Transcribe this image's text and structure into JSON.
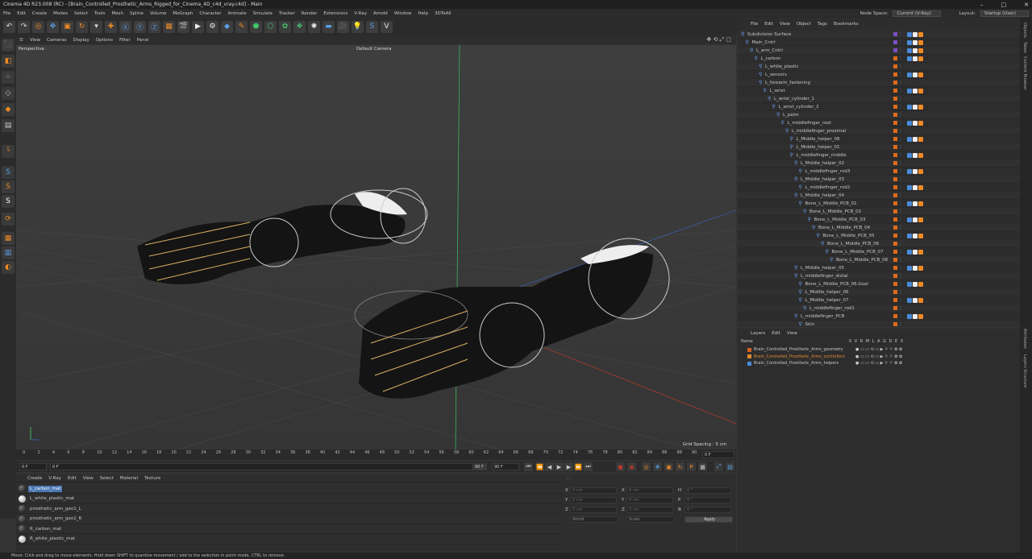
{
  "title": "Cinema 4D R23.008 (RC) - [Brain_Controlled_Prosthetic_Arms_Rigged_for_Cinema_4D_c4d_vray.c4d] - Main",
  "menu": [
    "File",
    "Edit",
    "Create",
    "Modes",
    "Select",
    "Tools",
    "Mesh",
    "Spline",
    "Volume",
    "MoGraph",
    "Character",
    "Animate",
    "Simulate",
    "Tracker",
    "Render",
    "Extensions",
    "V-Ray",
    "Arnold",
    "Window",
    "Help",
    "3DToAll"
  ],
  "node_space_label": "Node Space:",
  "node_space_value": "Current (V-Ray)",
  "layout_label": "Layout:",
  "layout_value": "Startup (User)",
  "viewport_menu": [
    "View",
    "Cameras",
    "Display",
    "Options",
    "Filter",
    "Panel"
  ],
  "viewport_name": "Perspective",
  "camera_name": "Default Camera",
  "grid_spacing": "Grid Spacing : 5 cm",
  "timeline_ticks": [
    "0",
    "2",
    "4",
    "6",
    "8",
    "10",
    "12",
    "14",
    "16",
    "18",
    "20",
    "22",
    "24",
    "26",
    "28",
    "30",
    "32",
    "34",
    "36",
    "38",
    "40",
    "42",
    "44",
    "46",
    "48",
    "50",
    "52",
    "54",
    "56",
    "58",
    "60",
    "62",
    "64",
    "66",
    "68",
    "70",
    "72",
    "74",
    "76",
    "78",
    "80",
    "82",
    "84",
    "86",
    "88",
    "90"
  ],
  "playback": {
    "start": "0 F",
    "current": "0 F",
    "end": "90 F",
    "end2": "90 F",
    "frame": "0 F"
  },
  "material_menu": [
    "Create",
    "V-Ray",
    "Edit",
    "View",
    "Select",
    "Material",
    "Texture"
  ],
  "materials": [
    "L_carbon_mat",
    "L_white_plastic_mat",
    "prosthetic_arm_geo1_L",
    "prosthetic_arm_geo1_R",
    "R_carbon_mat",
    "R_white_plastic_mat"
  ],
  "coords": {
    "x": "X",
    "y": "Y",
    "z": "Z",
    "h": "H",
    "p": "P",
    "b": "B",
    "val": "0 cm",
    "deg": "0 °",
    "mode": "World",
    "scale": "Scale",
    "apply": "Apply"
  },
  "status": "Move: Click and drag to move elements. Hold down SHIFT to quantize movement / add to the selection in point mode, CTRL to remove.",
  "object_menu": [
    "File",
    "Edit",
    "View",
    "Object",
    "Tags",
    "Bookmarks"
  ],
  "objects": [
    {
      "n": "Subdivision Surface",
      "d": 0
    },
    {
      "n": "Main_Cntrl",
      "d": 1
    },
    {
      "n": "L_arm_Cntrl",
      "d": 2
    },
    {
      "n": "L_carbon",
      "d": 3
    },
    {
      "n": "L_white_plastic",
      "d": 4
    },
    {
      "n": "L_sensors",
      "d": 4
    },
    {
      "n": "L_forearm_fastening",
      "d": 4
    },
    {
      "n": "L_wrist",
      "d": 5
    },
    {
      "n": "L_wrist_cylinder_1",
      "d": 6
    },
    {
      "n": "L_wrist_cylinder_2",
      "d": 7
    },
    {
      "n": "L_palm",
      "d": 8
    },
    {
      "n": "L_middlefinger_root",
      "d": 9
    },
    {
      "n": "L_middlefinger_proximal",
      "d": 10
    },
    {
      "n": "L_Middle_helper_08",
      "d": 11
    },
    {
      "n": "L_Middle_helper_01",
      "d": 11
    },
    {
      "n": "L_middlefinger_middle",
      "d": 11
    },
    {
      "n": "L_Middle_helper_02",
      "d": 12
    },
    {
      "n": "L_middlefinger_rod3",
      "d": 13
    },
    {
      "n": "L_Middle_helper_03",
      "d": 12
    },
    {
      "n": "L_middlefinger_rod2",
      "d": 13
    },
    {
      "n": "L_Middle_helper_04",
      "d": 12
    },
    {
      "n": "Bone_L_Middle_PCB_01",
      "d": 13
    },
    {
      "n": "Bone_L_Middle_PCB_02",
      "d": 14
    },
    {
      "n": "Bone_L_Middle_PCB_03",
      "d": 15
    },
    {
      "n": "Bone_L_Middle_PCB_04",
      "d": 16
    },
    {
      "n": "Bone_L_Middle_PCB_05",
      "d": 17
    },
    {
      "n": "Bone_L_Middle_PCB_06",
      "d": 18
    },
    {
      "n": "Bone_L_Middle_PCB_07",
      "d": 19
    },
    {
      "n": "Bone_L_Middle_PCB_08",
      "d": 20
    },
    {
      "n": "L_Middle_helper_05",
      "d": 12
    },
    {
      "n": "L_middlefinger_distal",
      "d": 12
    },
    {
      "n": "Bone_L_Middle_PCB_06.Goal",
      "d": 13
    },
    {
      "n": "L_Middle_helper_06",
      "d": 13
    },
    {
      "n": "L_Middle_helper_07",
      "d": 13
    },
    {
      "n": "L_middlefinger_rod1",
      "d": 14
    },
    {
      "n": "L_middlefinger_PCB",
      "d": 12
    },
    {
      "n": "Skin",
      "d": 13
    }
  ],
  "layers_menu": [
    "Layers",
    "Edit",
    "View"
  ],
  "layers_header": {
    "name": "Name",
    "cols": "S V R M L A G D E X"
  },
  "layers": [
    {
      "name": "Brain_Controlled_Prosthetic_Arms_geometry",
      "color": "#d06020"
    },
    {
      "name": "Brain_Controlled_Prosthetic_Arms_controllers",
      "color": "#e08a30"
    },
    {
      "name": "Brain_Controlled_Prosthetic_Arms_helpers",
      "color": "#4a8ad8"
    }
  ],
  "side_tabs": [
    "Objects",
    "Takes",
    "Content Browser",
    "Attributes",
    "Layers",
    "Structure"
  ],
  "colors": {
    "accent": "#f08a24",
    "select": "#4a78b4",
    "axis_green": "#3cb35a",
    "axis_red": "#c0392b"
  }
}
